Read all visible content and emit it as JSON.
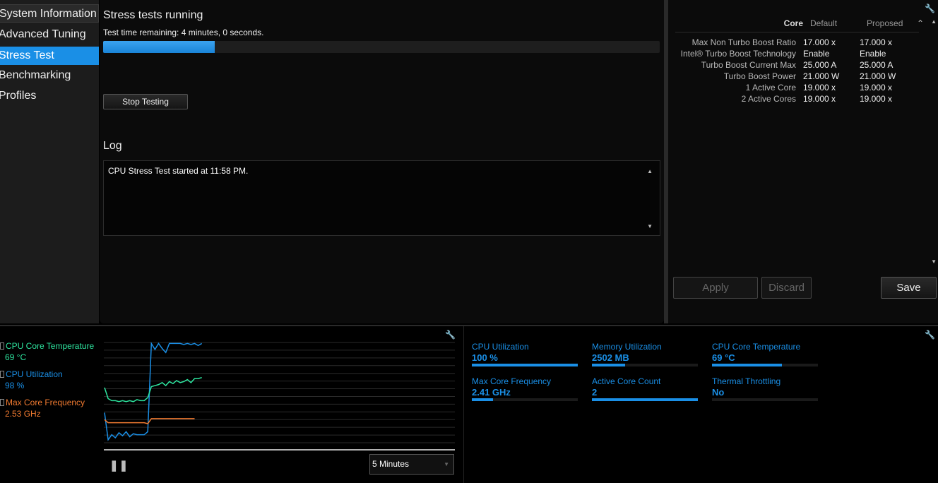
{
  "sidebar": {
    "items": [
      {
        "label": "System Information"
      },
      {
        "label": "Advanced Tuning"
      },
      {
        "label": "Stress Test",
        "selected": true
      },
      {
        "label": "Benchmarking"
      },
      {
        "label": "Profiles"
      }
    ]
  },
  "main": {
    "title": "Stress tests running",
    "remaining": "Test time remaining:  4 minutes, 0 seconds.",
    "progress_percent": 20,
    "stop_label": "Stop Testing",
    "log_title": "Log",
    "log_text": "CPU Stress Test started at 11:58 PM."
  },
  "tuning": {
    "headers": {
      "core": "Core",
      "default": "Default",
      "proposed": "Proposed"
    },
    "rows": [
      {
        "label": "Max Non Turbo Boost Ratio",
        "default": "17.000 x",
        "proposed": "17.000 x"
      },
      {
        "label": "Intel® Turbo Boost Technology",
        "default": "Enable",
        "proposed": "Enable"
      },
      {
        "label": "Turbo Boost Current Max",
        "default": "25.000 A",
        "proposed": "25.000 A"
      },
      {
        "label": "Turbo Boost Power",
        "default": "21.000 W",
        "proposed": "21.000 W"
      },
      {
        "label": "1 Active Core",
        "default": "19.000 x",
        "proposed": "19.000 x"
      },
      {
        "label": "2 Active Cores",
        "default": "19.000 x",
        "proposed": "19.000 x"
      }
    ],
    "apply_label": "Apply",
    "discard_label": "Discard",
    "save_label": "Save"
  },
  "monitor": {
    "legend": [
      {
        "name": "CPU Core Temperature",
        "value": "69 °C",
        "color": "#2ee6a0"
      },
      {
        "name": "CPU Utilization",
        "value": "98 %",
        "color": "#1a8fe6"
      },
      {
        "name": "Max Core Frequency",
        "value": "2.53 GHz",
        "color": "#f07a30"
      }
    ],
    "time_range": "5 Minutes",
    "metrics": [
      {
        "title": "CPU Utilization",
        "value": "100 %",
        "fill": 1.0
      },
      {
        "title": "Memory Utilization",
        "value": "2502  MB",
        "fill": 0.31
      },
      {
        "title": "CPU Core Temperature",
        "value": "69 °C",
        "fill": 0.66
      },
      {
        "title": "Max Core Frequency",
        "value": "2.41 GHz",
        "fill": 0.2
      },
      {
        "title": "Active Core Count",
        "value": "2",
        "fill": 1.0
      },
      {
        "title": "Thermal Throttling",
        "value": "No",
        "fill": 0
      }
    ]
  },
  "chart_data": {
    "type": "line",
    "ylim": [
      0,
      100
    ],
    "x_points": 28,
    "series": [
      {
        "name": "CPU Utilization",
        "color": "#1a8fe6",
        "values": [
          30,
          3,
          8,
          5,
          10,
          7,
          11,
          6,
          9,
          8,
          8,
          8,
          11,
          99,
          93,
          99,
          94,
          90,
          99,
          99,
          99,
          99,
          98,
          99,
          98,
          99,
          97,
          99
        ]
      },
      {
        "name": "CPU Core Temperature",
        "color": "#2ee6a0",
        "values": [
          55,
          44,
          42,
          42,
          41,
          42,
          41,
          42,
          41,
          43,
          42,
          42,
          45,
          56,
          57,
          58,
          60,
          57,
          61,
          59,
          62,
          60,
          61,
          63,
          60,
          64,
          64,
          65
        ]
      },
      {
        "name": "Max Core Frequency",
        "color": "#f07a30",
        "values": [
          23,
          20,
          20,
          20,
          20,
          20,
          20,
          20,
          20,
          20,
          20,
          20,
          19,
          24,
          24,
          24,
          24,
          24,
          24,
          24,
          24,
          24,
          24,
          24,
          24,
          24
        ]
      }
    ]
  }
}
